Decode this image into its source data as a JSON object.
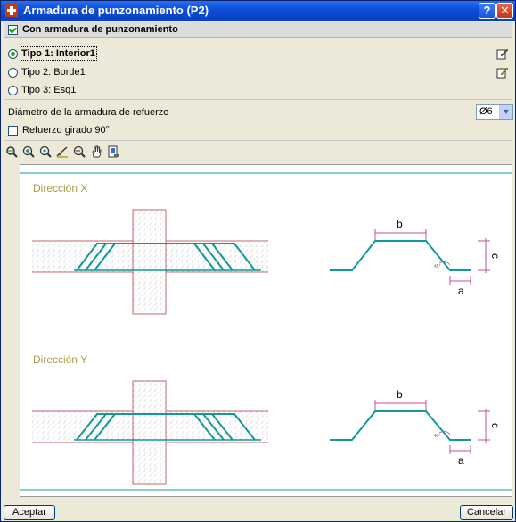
{
  "window": {
    "title": "Armadura de punzonamiento (P2)",
    "help_label": "?",
    "close_label": "✕"
  },
  "punching": {
    "enabled_label": "Con armadura de punzonamiento",
    "types": [
      {
        "label": "Tipo 1: Interior1",
        "selected": true
      },
      {
        "label": "Tipo 2: Borde1",
        "selected": false
      },
      {
        "label": "Tipo 3: Esq1",
        "selected": false
      }
    ]
  },
  "diameter": {
    "label": "Diámetro de la armadura de refuerzo",
    "value": "Ø6"
  },
  "rotated": {
    "label": "Refuerzo girado 90°"
  },
  "toolbar": {
    "icons": [
      "zoom-window-icon",
      "zoom-extents-icon",
      "zoom-icon",
      "measure-icon",
      "zoom-previous-icon",
      "pan-hand-icon",
      "print-preview-icon"
    ]
  },
  "drawing": {
    "dir_x_label": "Dirección X",
    "dir_y_label": "Dirección Y",
    "dim_b": "b",
    "dim_c": "c",
    "dim_a": "a",
    "angle_label": "45°",
    "accent_color": "#139898",
    "concrete_color": "#c06868",
    "title_color": "#a89a4a"
  },
  "buttons": {
    "accept": "Aceptar",
    "cancel": "Cancelar"
  }
}
